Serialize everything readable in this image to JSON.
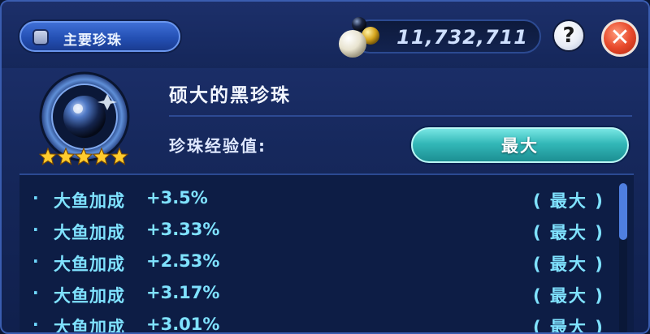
{
  "header": {
    "tab_label": "主要珍珠",
    "coins": "11,732,711",
    "help_glyph": "?",
    "close_glyph": "✕"
  },
  "pearl": {
    "name": "硕大的黑珍珠",
    "stars": 5,
    "exp_label": "珍珠经验值:",
    "exp_value": "最大"
  },
  "bonuses": [
    {
      "label": "大鱼加成",
      "value": "+3.5%",
      "status": "( 最大 )"
    },
    {
      "label": "大鱼加成",
      "value": "+3.33%",
      "status": "( 最大 )"
    },
    {
      "label": "大鱼加成",
      "value": "+2.53%",
      "status": "( 最大 )"
    },
    {
      "label": "大鱼加成",
      "value": "+3.17%",
      "status": "( 最大 )"
    },
    {
      "label": "大鱼加成",
      "value": "+3.01%",
      "status": "( 最大 )"
    }
  ],
  "bullet": "·",
  "colors": {
    "accent": "#7fe2ff",
    "exp_bar": "#33b8b8",
    "close": "#e84a2c",
    "tab": "#2450b4"
  },
  "icons": [
    "toggle-icon",
    "pearls-icon",
    "help-icon",
    "close-icon",
    "black-pearl-icon",
    "star-icon"
  ]
}
